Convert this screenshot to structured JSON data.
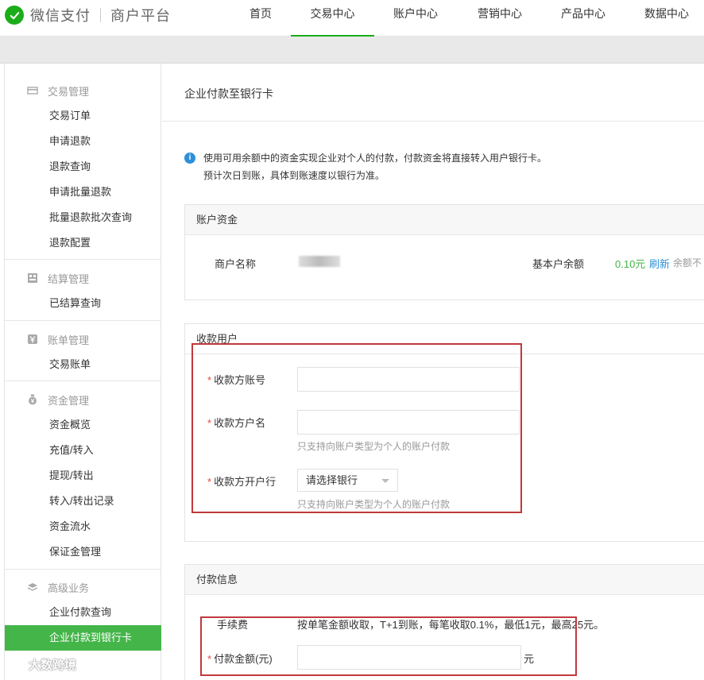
{
  "brand": {
    "name": "微信支付",
    "platform": "商户平台"
  },
  "nav": [
    {
      "label": "首页",
      "active": false
    },
    {
      "label": "交易中心",
      "active": true
    },
    {
      "label": "账户中心",
      "active": false
    },
    {
      "label": "营销中心",
      "active": false
    },
    {
      "label": "产品中心",
      "active": false
    },
    {
      "label": "数据中心",
      "active": false
    }
  ],
  "sidebar": {
    "groups": [
      {
        "title": "交易管理",
        "icon": "card-icon",
        "items": [
          "交易订单",
          "申请退款",
          "退款查询",
          "申请批量退款",
          "批量退款批次查询",
          "退款配置"
        ]
      },
      {
        "title": "结算管理",
        "icon": "grid-icon",
        "items": [
          "已结算查询"
        ]
      },
      {
        "title": "账单管理",
        "icon": "yen-icon",
        "items": [
          "交易账单"
        ]
      },
      {
        "title": "资金管理",
        "icon": "money-bag-icon",
        "items": [
          "资金概览",
          "充值/转入",
          "提现/转出",
          "转入/转出记录",
          "资金流水",
          "保证金管理"
        ]
      },
      {
        "title": "高级业务",
        "icon": "layers-icon",
        "items": [
          "企业付款查询",
          "企业付款到银行卡"
        ]
      }
    ],
    "active_item": "企业付款到银行卡"
  },
  "page": {
    "title": "企业付款至银行卡",
    "notice_line1": "使用可用余额中的资金实现企业对个人的付款，付款资金将直接转入用户银行卡。",
    "notice_line2": "预计次日到账，具体到账速度以银行为准。"
  },
  "account_panel": {
    "header": "账户资金",
    "merchant_label": "商户名称",
    "balance_label": "基本户余额",
    "balance_value": "0.10元",
    "refresh_link": "刷新",
    "balance_note": "余额不"
  },
  "payee_panel": {
    "header": "收款用户",
    "account_label": "收款方账号",
    "account_value": "",
    "name_label": "收款方户名",
    "name_value": "",
    "name_hint": "只支持向账户类型为个人的账户付款",
    "bank_label": "收款方开户行",
    "bank_select": "请选择银行",
    "bank_hint": "只支持向账户类型为个人的账户付款"
  },
  "payment_panel": {
    "header": "付款信息",
    "fee_label": "手续费",
    "fee_text": "按单笔金额收取，T+1到账，每笔收取0.1%，最低1元，最高25元。",
    "amount_label": "付款金额(元)",
    "amount_value": "",
    "amount_unit": "元"
  },
  "watermark": "大数跨境",
  "colors": {
    "accent": "#1aad19",
    "active_bg": "#44b549",
    "link": "#2e8fd9",
    "balance": "#44b549",
    "highlight_box": "#c0393b"
  }
}
